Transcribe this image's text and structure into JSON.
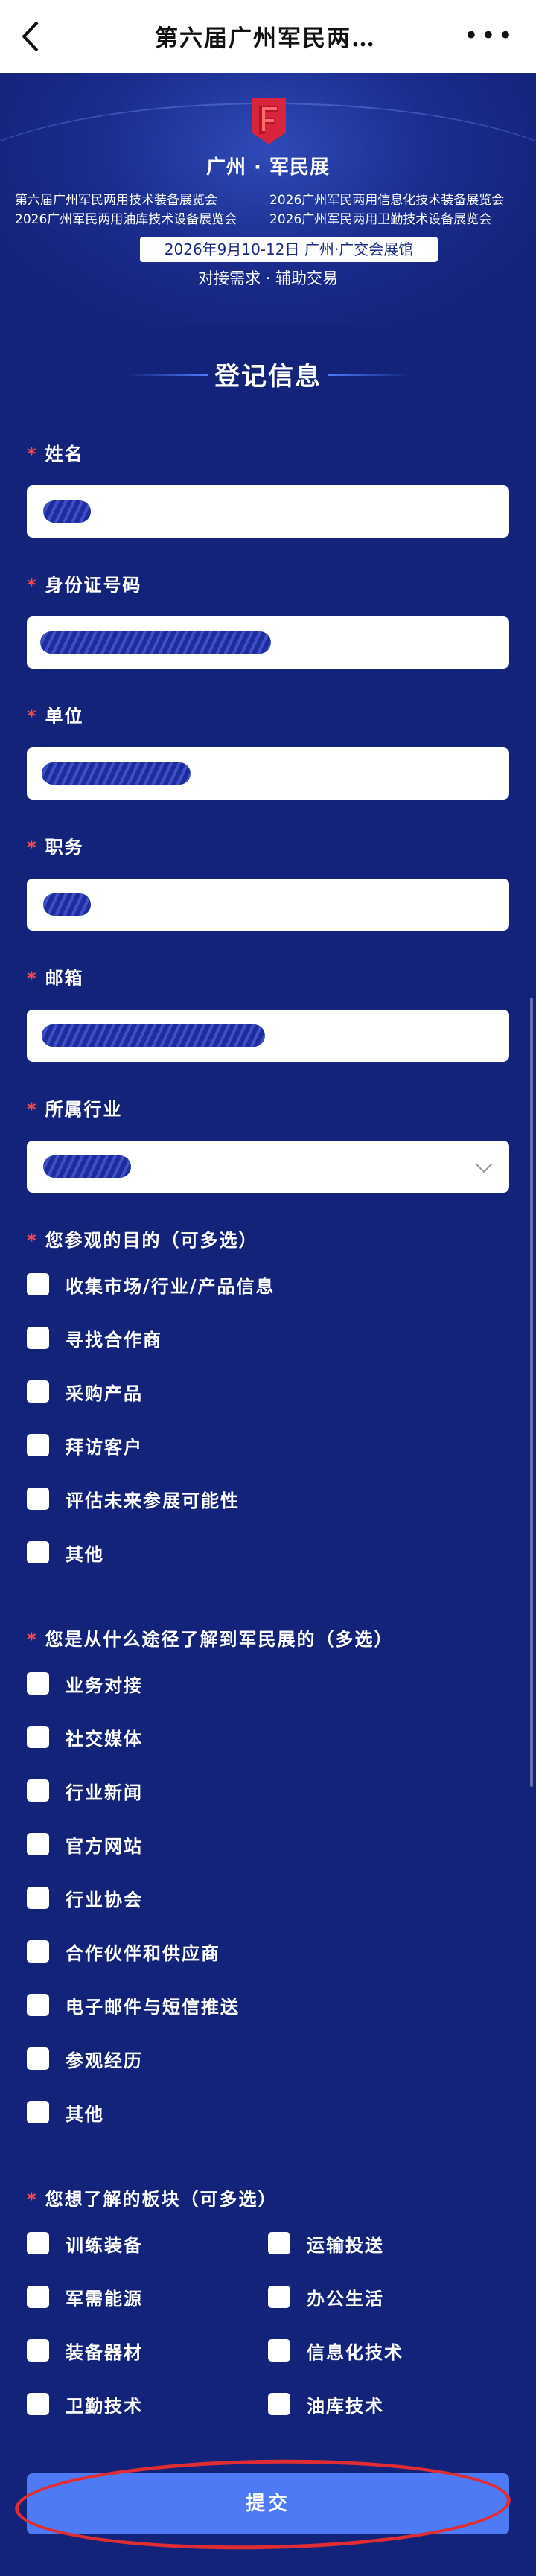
{
  "header": {
    "title": "第六届广州军民两…",
    "more": "•••"
  },
  "banner": {
    "brand": "广州 · 军民展",
    "exhibitions": [
      "第六届广州军民两用技术装备展览会",
      "2026广州军民两用信息化技术装备展览会",
      "2026广州军民两用油库技术设备展览会",
      "2026广州军民两用卫勤技术设备展览会"
    ],
    "date_venue": "2026年9月10-12日  广州·广交会展馆",
    "slogan": "对接需求 · 辅助交易",
    "colors": {
      "logo_red": "#d8243c",
      "background": "#14237a"
    }
  },
  "form": {
    "section_title": "登记信息",
    "required_mark": "*",
    "name_label": "姓名",
    "id_label": "身份证号码",
    "company_label": "单位",
    "position_label": "职务",
    "email_label": "邮箱",
    "industry_label": "所属行业",
    "purpose_label": "您参观的目的（可多选）",
    "purpose_options": [
      "收集市场/行业/产品信息",
      "寻找合作商",
      "采购产品",
      "拜访客户",
      "评估未来参展可能性",
      "其他"
    ],
    "channel_label": "您是从什么途径了解到军民展的（多选）",
    "channel_options": [
      "业务对接",
      "社交媒体",
      "行业新闻",
      "官方网站",
      "行业协会",
      "合作伙伴和供应商",
      "电子邮件与短信推送",
      "参观经历",
      "其他"
    ],
    "sector_label": "您想了解的板块（可多选）",
    "sector_options": [
      "训练装备",
      "运输投送",
      "军需能源",
      "办公生活",
      "装备器材",
      "信息化技术",
      "卫勤技术",
      "油库技术"
    ],
    "submit_label": "提交",
    "colors": {
      "submit": "#4e7bf5",
      "required": "#ff4a4a",
      "annotation_ring": "#e02d33"
    }
  }
}
